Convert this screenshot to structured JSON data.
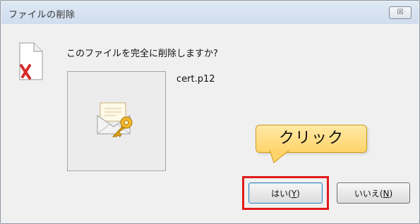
{
  "dialog": {
    "title": "ファイルの削除",
    "close_label": "☒",
    "question": "このファイルを完全に削除しますか?",
    "filename": "cert.p12"
  },
  "buttons": {
    "yes": {
      "label": "はい(",
      "accel": "Y",
      "close": ")"
    },
    "no": {
      "label": "いいえ(",
      "accel": "N",
      "close": ")"
    }
  },
  "annotation": {
    "callout_text": "クリック",
    "highlight_color": "#e11b1b",
    "callout_color": "#ffd46a"
  },
  "icons": {
    "file": "deleted-file-icon",
    "preview": "certificate-envelope-key-icon"
  }
}
